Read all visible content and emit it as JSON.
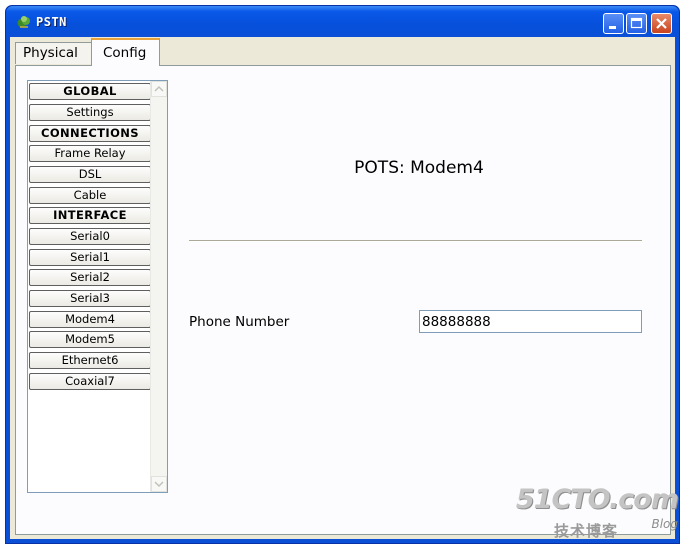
{
  "window": {
    "title": "PSTN",
    "icon": "cloud-globe-icon",
    "controls": [
      "minimize",
      "maximize",
      "close"
    ]
  },
  "tabs": [
    {
      "label": "Physical",
      "active": false
    },
    {
      "label": "Config",
      "active": true
    }
  ],
  "sidebar": {
    "items": [
      {
        "label": "GLOBAL",
        "type": "header"
      },
      {
        "label": "Settings",
        "type": "item"
      },
      {
        "label": "CONNECTIONS",
        "type": "header"
      },
      {
        "label": "Frame Relay",
        "type": "item"
      },
      {
        "label": "DSL",
        "type": "item"
      },
      {
        "label": "Cable",
        "type": "item"
      },
      {
        "label": "INTERFACE",
        "type": "header"
      },
      {
        "label": "Serial0",
        "type": "item"
      },
      {
        "label": "Serial1",
        "type": "item"
      },
      {
        "label": "Serial2",
        "type": "item"
      },
      {
        "label": "Serial3",
        "type": "item"
      },
      {
        "label": "Modem4",
        "type": "item"
      },
      {
        "label": "Modem5",
        "type": "item"
      },
      {
        "label": "Ethernet6",
        "type": "item"
      },
      {
        "label": "Coaxial7",
        "type": "item"
      }
    ]
  },
  "main": {
    "title": "POTS: Modem4",
    "phone_label": "Phone Number",
    "phone_value": "88888888"
  },
  "watermark": {
    "main": "51CTO.com",
    "sub": "技术博客",
    "blog": "Blog"
  }
}
